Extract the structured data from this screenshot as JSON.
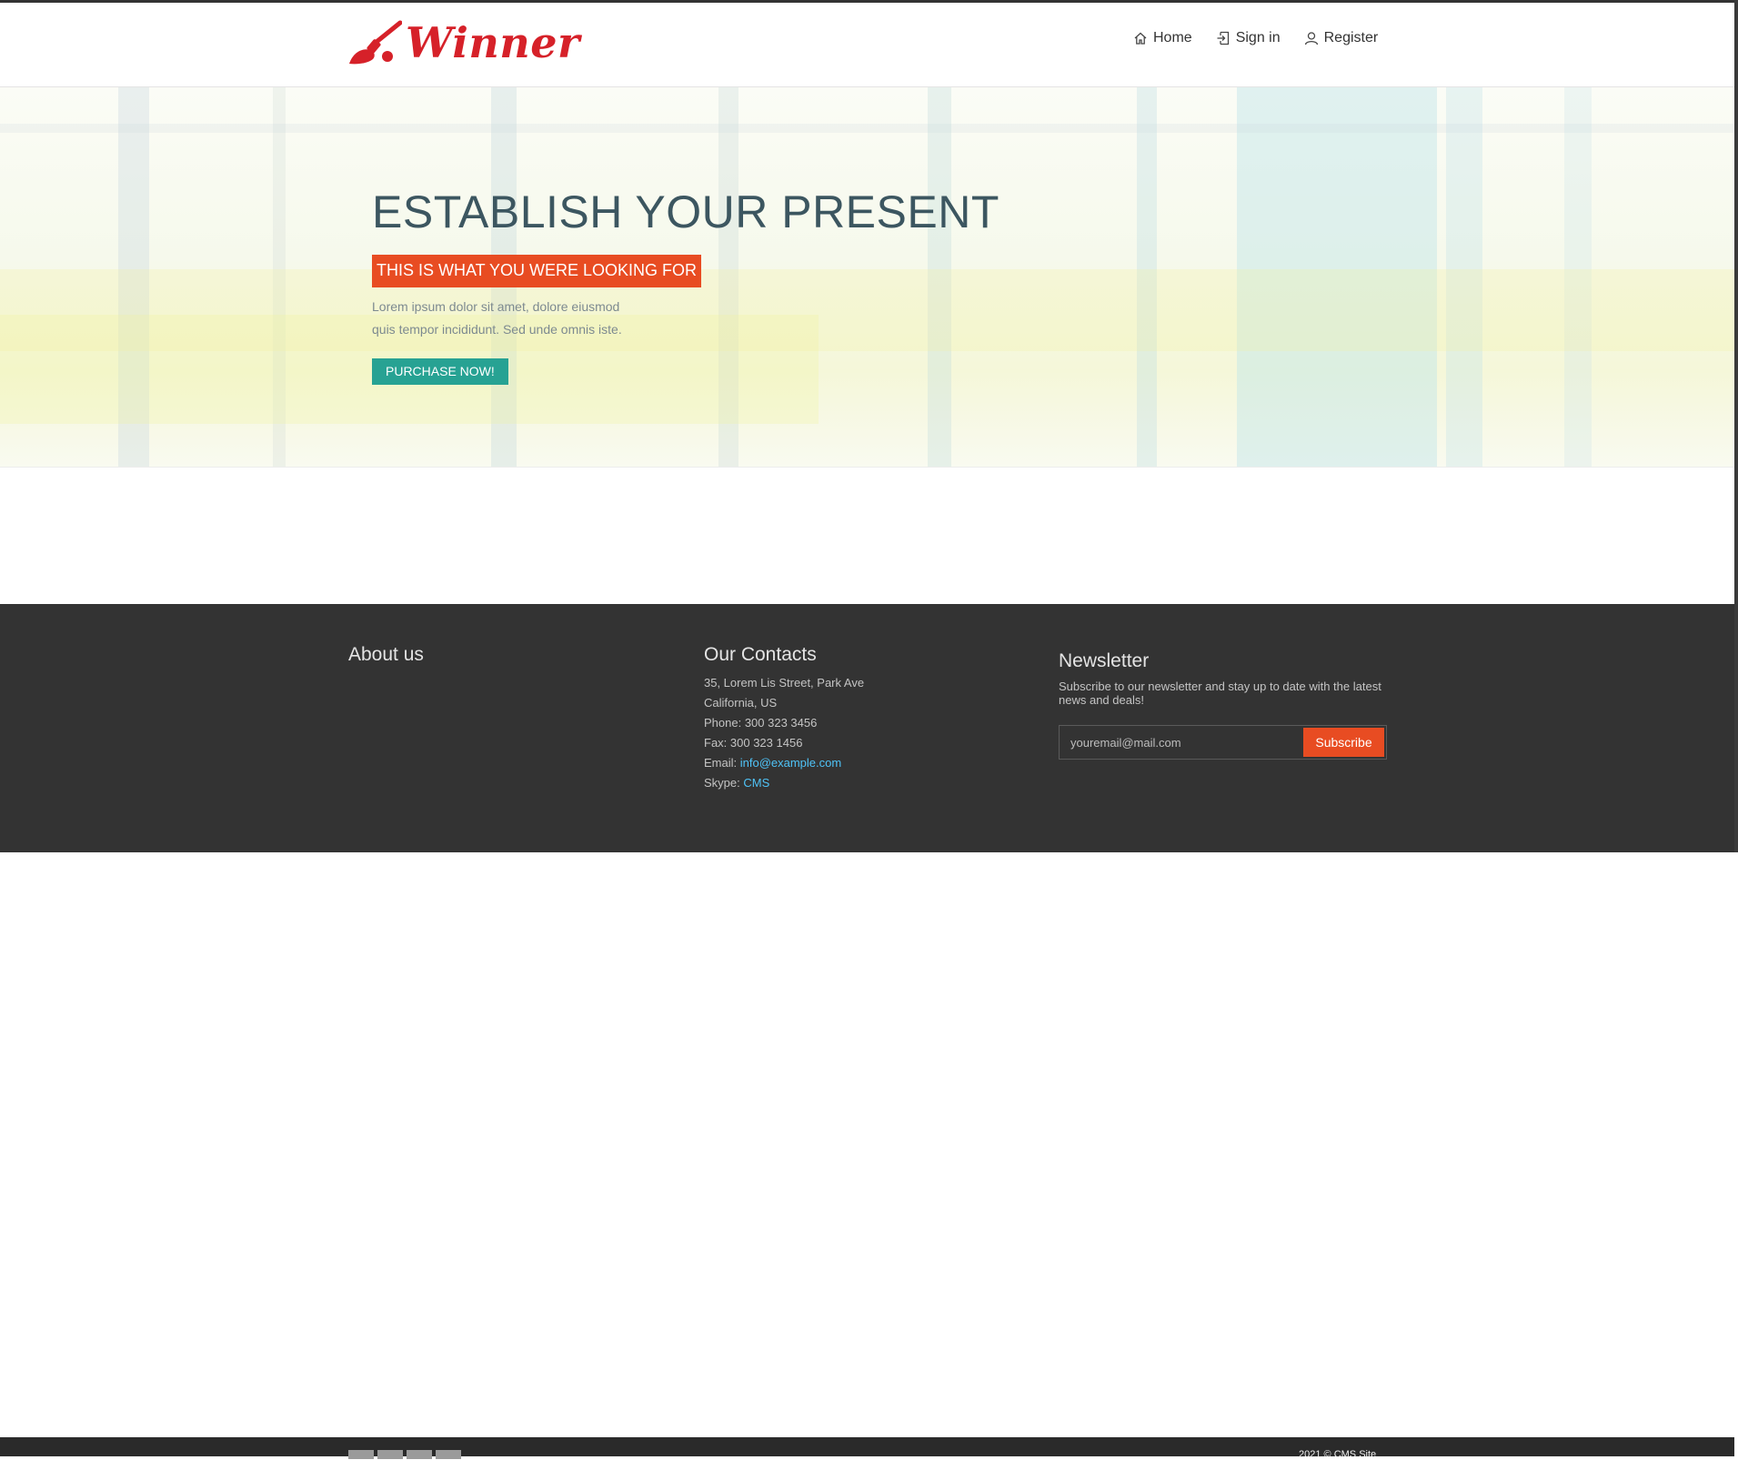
{
  "brand": {
    "name": "Winner",
    "color": "#d62129"
  },
  "nav": {
    "items": [
      {
        "label": "Home",
        "icon": "home-icon"
      },
      {
        "label": "Sign in",
        "icon": "sign-in-icon"
      },
      {
        "label": "Register",
        "icon": "user-icon"
      }
    ]
  },
  "hero": {
    "title": "ESTABLISH YOUR PRESENT",
    "tagline": "THIS IS WHAT YOU WERE LOOKING FOR",
    "text": "Lorem ipsum dolor sit amet, dolore eiusmod quis tempor incididunt. Sed unde omnis iste.",
    "button_label": "PURCHASE NOW!",
    "colors": {
      "tag": "#e84c22",
      "button": "#27a293",
      "title": "#3c5660"
    }
  },
  "footer": {
    "about": {
      "heading": "About us"
    },
    "contacts": {
      "heading": "Our Contacts",
      "address_line1": "35, Lorem Lis Street, Park Ave",
      "address_line2": "California, US",
      "phone": "Phone: 300 323 3456",
      "fax": "Fax: 300 323 1456",
      "email_label": "Email: ",
      "email": "info@example.com",
      "skype_label": "Skype: ",
      "skype": "CMS"
    },
    "newsletter": {
      "heading": "Newsletter",
      "text": "Subscribe to our newsletter and stay up to date with the latest news and deals!",
      "email_placeholder": "youremail@mail.com",
      "button_label": "Subscribe"
    },
    "copyright": "2021 © CMS Site",
    "colors": {
      "background": "#333333",
      "link": "#4fc3f7"
    }
  }
}
